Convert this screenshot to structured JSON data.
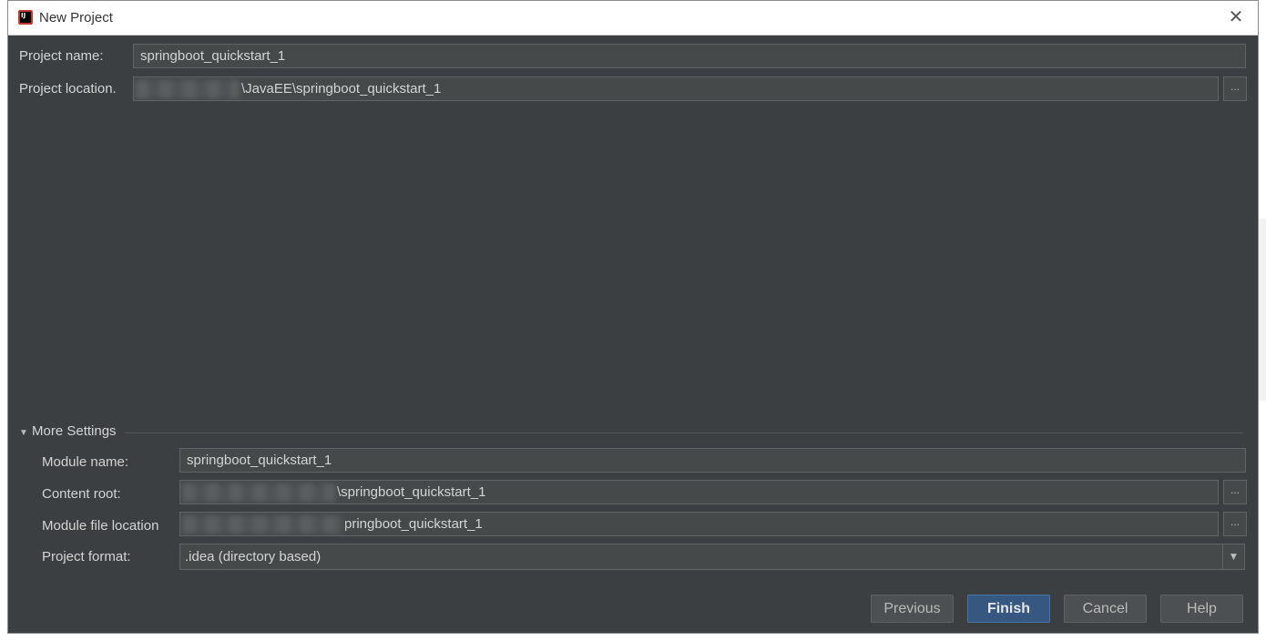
{
  "window": {
    "title": "New Project",
    "close_glyph": "✕"
  },
  "project_name": {
    "label": "Project name:",
    "value": "springboot_quickstart_1"
  },
  "project_location": {
    "label": "Project location.",
    "value": "\\JavaEE\\springboot_quickstart_1",
    "browse": "..."
  },
  "more_settings": {
    "label": "More Settings",
    "module_name": {
      "label": "Module name:",
      "value": "springboot_quickstart_1"
    },
    "content_root": {
      "label": "Content root:",
      "value": "\\springboot_quickstart_1",
      "browse": "..."
    },
    "module_file_location": {
      "label": "Module file location",
      "value": "pringboot_quickstart_1",
      "browse": "..."
    },
    "project_format": {
      "label": "Project format:",
      "selected": ".idea (directory based)"
    }
  },
  "buttons": {
    "previous": "Previous",
    "finish": "Finish",
    "cancel": "Cancel",
    "help": "Help"
  },
  "colors": {
    "dialog_bg": "#3c3f41",
    "field_bg": "#45494a",
    "primary_button": "#365880"
  }
}
